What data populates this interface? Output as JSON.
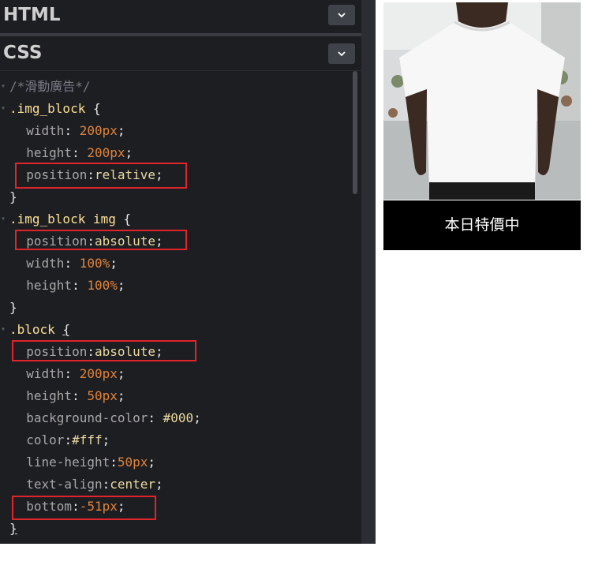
{
  "panels": {
    "html_title": "HTML",
    "css_title": "CSS"
  },
  "code_lines": [
    [
      "/*滑動廣告*/"
    ],
    [
      ".img_block",
      " {"
    ],
    [
      "  width",
      ": ",
      "200px",
      ";"
    ],
    [
      "  height",
      ": ",
      "200px",
      ";"
    ],
    [
      "  position",
      ":",
      "relative",
      ";"
    ],
    [
      "}"
    ],
    [
      ".img_block img",
      " {"
    ],
    [
      "  position",
      ":",
      "absolute",
      ";"
    ],
    [
      "  width",
      ": ",
      "100%",
      ";"
    ],
    [
      "  height",
      ": ",
      "100%",
      ";"
    ],
    [
      "}"
    ],
    [
      ".block",
      " ",
      "{"
    ],
    [
      "  position",
      ":",
      "absolute",
      ";"
    ],
    [
      "  width",
      ": ",
      "200px",
      ";"
    ],
    [
      "  height",
      ": ",
      "50px",
      ";"
    ],
    [
      "  background-color",
      ": ",
      "#000",
      ";"
    ],
    [
      "  color",
      ":",
      "#fff",
      ";"
    ],
    [
      "  line-height",
      ":",
      "50px",
      ";"
    ],
    [
      "  text-align",
      ":",
      "center",
      ";"
    ],
    [
      "  bottom",
      ":",
      "-51px",
      ";"
    ],
    [
      "}"
    ]
  ],
  "preview": {
    "badge_text": "本日特價中",
    "image": "white-tshirt-model-photo"
  },
  "colors": {
    "editor_bg": "#1d1e22",
    "highlight_border": "#e0242c"
  }
}
